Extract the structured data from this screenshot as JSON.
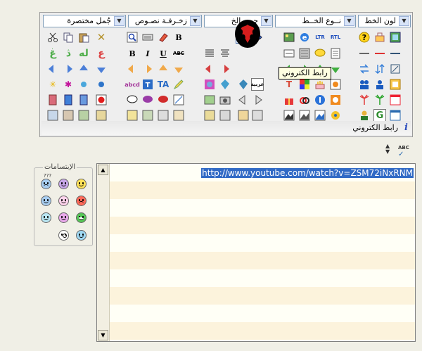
{
  "dropdowns": {
    "font_color": "لون الخط",
    "font_type": "نــوع الخــط",
    "font_size": "حجم الخ",
    "text_decor": "زخـرفـة نصـوص",
    "short_phrases": "جُمل مختصرة"
  },
  "tooltip": "رابط الكتروني",
  "status_text": "رابط الكتروني",
  "info_glyph": "i",
  "smilies_title": "الإبتسامات",
  "smilies_more": "???",
  "spell_check": "ABC",
  "editor_text": "http://www.youtube.com/watch?v=ZSM72iNxRNM",
  "scroll_up": "▲",
  "scroll_down": "▼",
  "format_letters": {
    "bold": "B",
    "italic": "I",
    "underline": "U",
    "strike": "ABC",
    "bold2": "B"
  },
  "colors": {
    "accent": "#316ac5",
    "select_bg": "#dbe6f7",
    "line1": "#fffff6",
    "line2": "#fcf3dc"
  }
}
